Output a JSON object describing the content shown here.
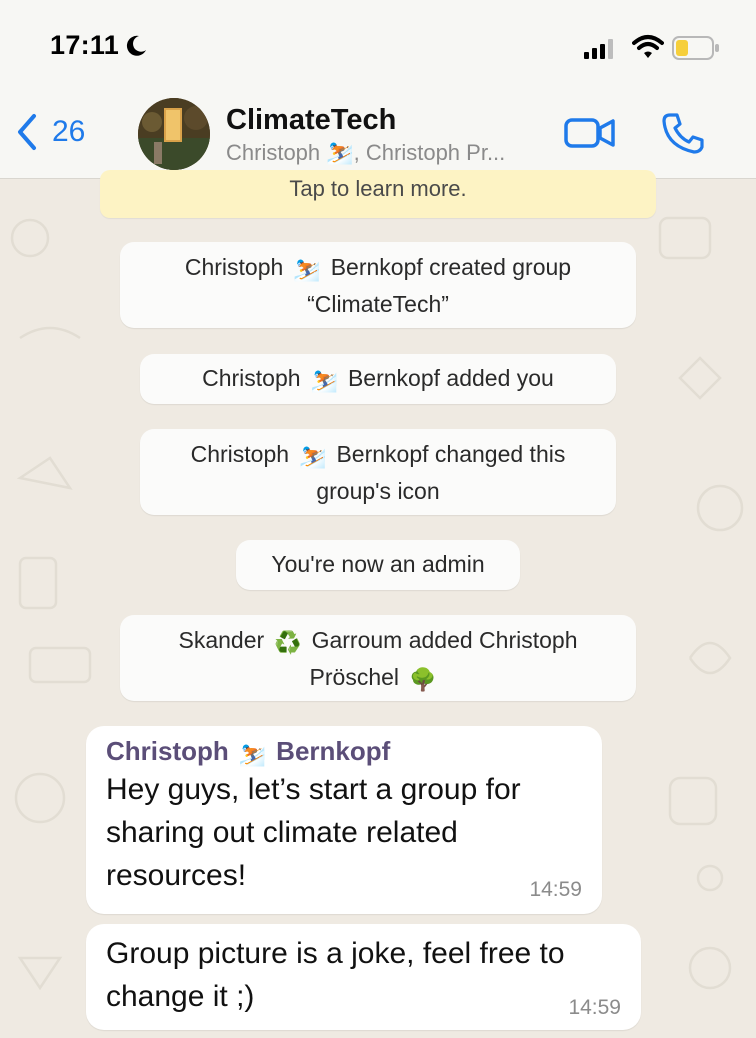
{
  "status_bar": {
    "time": "17:11"
  },
  "header": {
    "back_count": "26",
    "group_name": "ClimateTech",
    "members": "Christoph ⛷️, Christoph Pr..."
  },
  "banner": {
    "text": "Tap to learn more."
  },
  "system_messages": [
    {
      "line1": "Christoph",
      "emoji": "⛷️",
      "line1b": "Bernkopf created group",
      "line2": "“ClimateTech”"
    },
    {
      "text_a": "Christoph",
      "emoji": "⛷️",
      "text_b": "Bernkopf added you"
    },
    {
      "line1": "Christoph",
      "emoji": "⛷️",
      "line1b": "Bernkopf changed this",
      "line2": "group's icon"
    },
    {
      "text": "You're now an admin"
    },
    {
      "line1": "Skander",
      "emoji": "♻️",
      "line1b": "Garroum added Christoph",
      "line2": "Pröschel",
      "emoji2": "🌳"
    }
  ],
  "messages": [
    {
      "sender_first": "Christoph",
      "sender_emoji": "⛷️",
      "sender_last": "Bernkopf",
      "line1": "Hey guys, let’s start a group for",
      "line2": "sharing out climate related",
      "line3": "resources!",
      "time": "14:59"
    },
    {
      "line1": "Group picture is a joke, feel free to",
      "line2": "change it ;)",
      "time": "14:59"
    }
  ],
  "colors": {
    "accent": "#1f7aea",
    "sender_name": "#5b4e78",
    "banner": "#fdf3c4",
    "wallpaper": "#efeae2"
  },
  "icons": {
    "back": "chevron-left-icon",
    "video": "video-camera-icon",
    "call": "phone-icon",
    "moon": "moon-icon",
    "signal": "cellular-signal-icon",
    "wifi": "wifi-icon",
    "battery": "battery-icon"
  }
}
